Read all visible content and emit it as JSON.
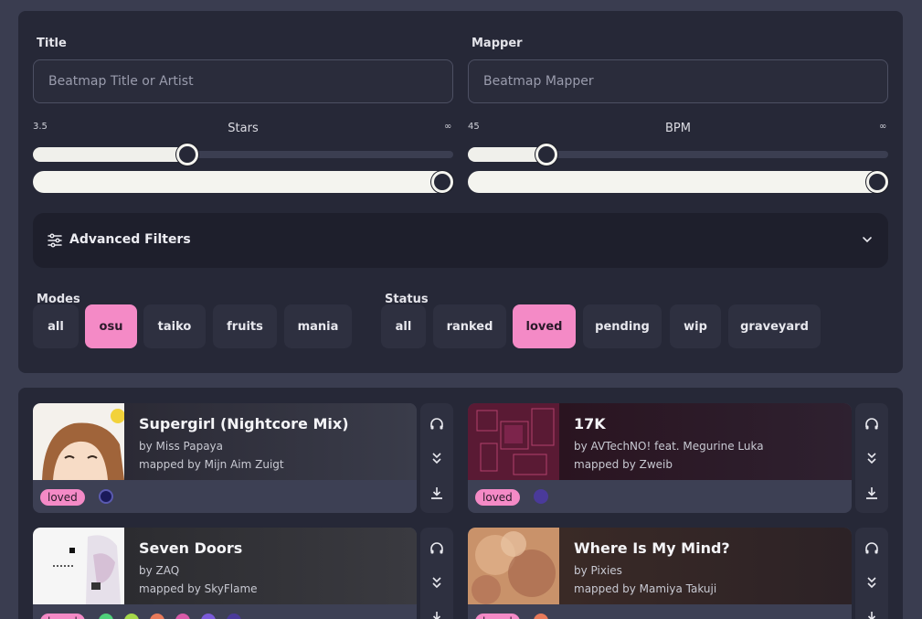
{
  "search": {
    "title_label": "Title",
    "title_placeholder": "Beatmap Title or Artist",
    "mapper_label": "Mapper",
    "mapper_placeholder": "Beatmap Mapper"
  },
  "stars": {
    "label": "Stars",
    "min_value": "3.5",
    "max_value": "∞",
    "low_fraction": 0.36,
    "high_fraction": 1.0
  },
  "bpm": {
    "label": "BPM",
    "min_value": "45",
    "max_value": "∞",
    "low_fraction": 0.17,
    "high_fraction": 1.0
  },
  "advanced": {
    "label": "Advanced Filters",
    "icon": "sliders-icon",
    "chevron": "chevron-down-icon"
  },
  "modes": {
    "label": "Modes",
    "items": [
      "all",
      "osu",
      "taiko",
      "fruits",
      "mania"
    ],
    "active": "osu"
  },
  "status": {
    "label": "Status",
    "items": [
      "all",
      "ranked",
      "loved",
      "pending",
      "wip",
      "graveyard"
    ],
    "active": "loved"
  },
  "colors": {
    "accent": "#f48ac6",
    "panel": "#262837",
    "background": "#3a3d50"
  },
  "beatmaps": [
    {
      "title": "Supergirl (Nightcore Mix)",
      "artist": "by Miss Papaya",
      "mapper": "mapped by Mijn Aim Zuigt",
      "status": "loved",
      "difficulty_colors": [
        "#1a1a5a"
      ]
    },
    {
      "title": "17K",
      "artist": "by AVTechNO! feat. Megurine Luka",
      "mapper": "mapped by Zweib",
      "status": "loved",
      "difficulty_colors": [
        "#4a3a9a"
      ]
    },
    {
      "title": "Seven Doors",
      "artist": "by ZAQ",
      "mapper": "mapped by SkyFlame",
      "status": "loved",
      "difficulty_colors": [
        "#4fd07a",
        "#a5d84a",
        "#e87a5a",
        "#d85aa8",
        "#7a5ad8",
        "#4a3a9a"
      ]
    },
    {
      "title": "Where Is My Mind?",
      "artist": "by Pixies",
      "mapper": "mapped by Mamiya Takuji",
      "status": "loved",
      "difficulty_colors": [
        "#e87a5a"
      ]
    }
  ],
  "card_actions": {
    "preview_icon": "headphones-icon",
    "expand_icon": "chevrons-down-icon",
    "download_icon": "download-icon"
  }
}
